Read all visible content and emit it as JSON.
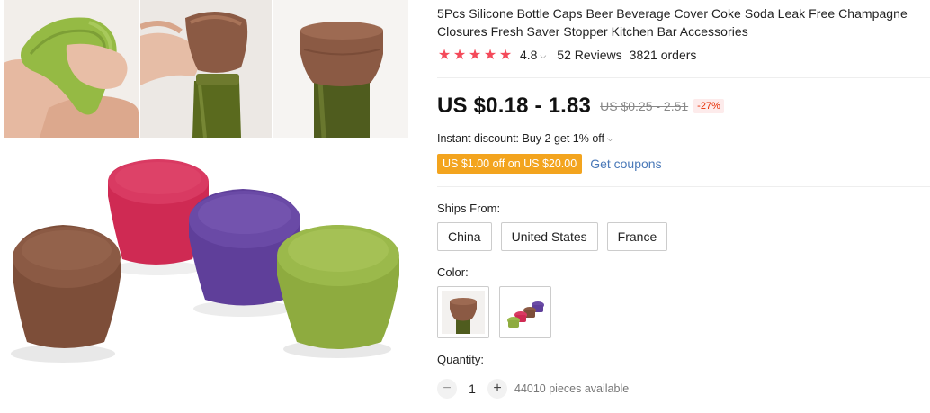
{
  "product": {
    "title": "5Pcs Silicone Bottle Caps Beer Beverage Cover Coke Soda Leak Free Champagne Closures Fresh Saver Stopper Kitchen Bar Accessories"
  },
  "rating": {
    "stars": 5,
    "score": "4.8",
    "reviews": "52 Reviews",
    "orders": "3821 orders"
  },
  "price": {
    "current": "US $0.18 - 1.83",
    "original": "US $0.25 - 2.51",
    "discount": "-27%"
  },
  "promo": {
    "instant_discount": "Instant discount: Buy 2 get 1% off",
    "coupon_tag": "US $1.00 off on US $20.00",
    "get_coupons": "Get coupons"
  },
  "shipping": {
    "label": "Ships From:",
    "options": [
      "China",
      "United States",
      "France"
    ]
  },
  "color": {
    "label": "Color:"
  },
  "quantity": {
    "label": "Quantity:",
    "value": "1",
    "minus": "−",
    "plus": "+",
    "available": "44010 pieces available"
  },
  "colors": {
    "star": "#f44a5a",
    "coupon_bg": "#f3a41e",
    "link": "#4a79b8",
    "discount_text": "#e62e04",
    "cap_brown": "#8b5a44",
    "cap_pink": "#d42a55",
    "cap_purple": "#6a4aa6",
    "cap_green": "#9bb94b"
  }
}
